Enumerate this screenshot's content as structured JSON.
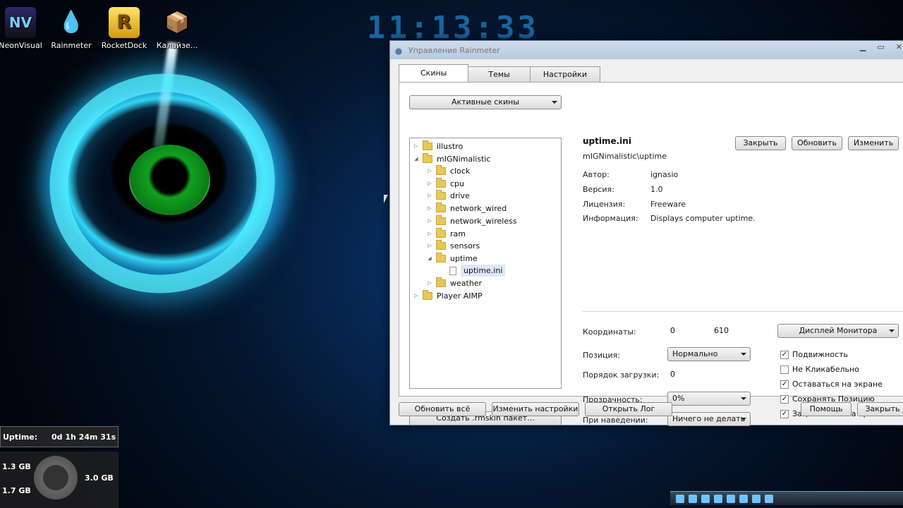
{
  "desktop": {
    "icons": [
      {
        "label": "NeonVisual",
        "glyph": "NV"
      },
      {
        "label": "Rainmeter",
        "glyph": "💧"
      },
      {
        "label": "RocketDock",
        "glyph": "R"
      },
      {
        "label": "Калайзе...",
        "glyph": "📦"
      }
    ],
    "clock": "11:13:33"
  },
  "window": {
    "title": "Управление Rainmeter",
    "tabs": [
      "Скины",
      "Темы",
      "Настройки"
    ],
    "active_skins_dropdown": "Активные скины",
    "tree": {
      "nodes": [
        {
          "label": "illustro",
          "type": "folder",
          "expanded": false
        },
        {
          "label": "mIGNimalistic",
          "type": "folder",
          "expanded": true
        },
        {
          "label": "clock",
          "type": "folder"
        },
        {
          "label": "cpu",
          "type": "folder"
        },
        {
          "label": "drive",
          "type": "folder"
        },
        {
          "label": "network_wired",
          "type": "folder"
        },
        {
          "label": "network_wireless",
          "type": "folder"
        },
        {
          "label": "ram",
          "type": "folder"
        },
        {
          "label": "sensors",
          "type": "folder"
        },
        {
          "label": "uptime",
          "type": "folder",
          "expanded": true
        },
        {
          "label": "uptime.ini",
          "type": "file",
          "selected": true
        },
        {
          "label": "weather",
          "type": "folder"
        },
        {
          "label": "Player AIMP",
          "type": "folder"
        }
      ]
    },
    "create_package_button": "Создать .rmskin пакет...",
    "skin": {
      "filename": "uptime.ini",
      "path": "mIGNimalistic\\uptime",
      "author_label": "Автор:",
      "author": "ignasio",
      "version_label": "Версия:",
      "version": "1.0",
      "license_label": "Лицензия:",
      "license": "Freeware",
      "info_label": "Информация:",
      "info": "Displays computer uptime."
    },
    "top_buttons": {
      "close": "Закрыть",
      "refresh": "Обновить",
      "edit": "Изменить"
    },
    "settings": {
      "coords_label": "Координаты:",
      "coord_x": "0",
      "coord_y": "610",
      "monitor": "Дисплей Монитора",
      "position_label": "Позиция:",
      "position": "Нормально",
      "load_order_label": "Порядок загрузки:",
      "load_order": "0",
      "transparency_label": "Прозрачность:",
      "transparency": "0%",
      "hover_label": "При наведении:",
      "hover": "Ничего не делать"
    },
    "checkboxes": [
      {
        "label": "Подвижность",
        "checked": true
      },
      {
        "label": "Не Кликабельно",
        "checked": false
      },
      {
        "label": "Оставаться на экране",
        "checked": true
      },
      {
        "label": "Сохранять Позицию",
        "checked": true
      },
      {
        "label": "Зацепляться за края",
        "checked": true
      }
    ],
    "bottom_buttons": {
      "refresh_all": "Обновить всё",
      "edit_settings": "Изменить настройки",
      "open_log": "Открыть Лог",
      "help": "Помощь",
      "close": "Закрыть"
    }
  },
  "widgets": {
    "uptime_label": "Uptime:",
    "uptime_value": "0d 1h 24m 31s",
    "ram_used": "1.3 GB",
    "ram_free": "1.7 GB",
    "ram_total": "3.0 GB"
  },
  "colors": {
    "accent": "#3fd6ff",
    "folder": "#e9c85a",
    "window_bg": "#f0f0f0"
  }
}
